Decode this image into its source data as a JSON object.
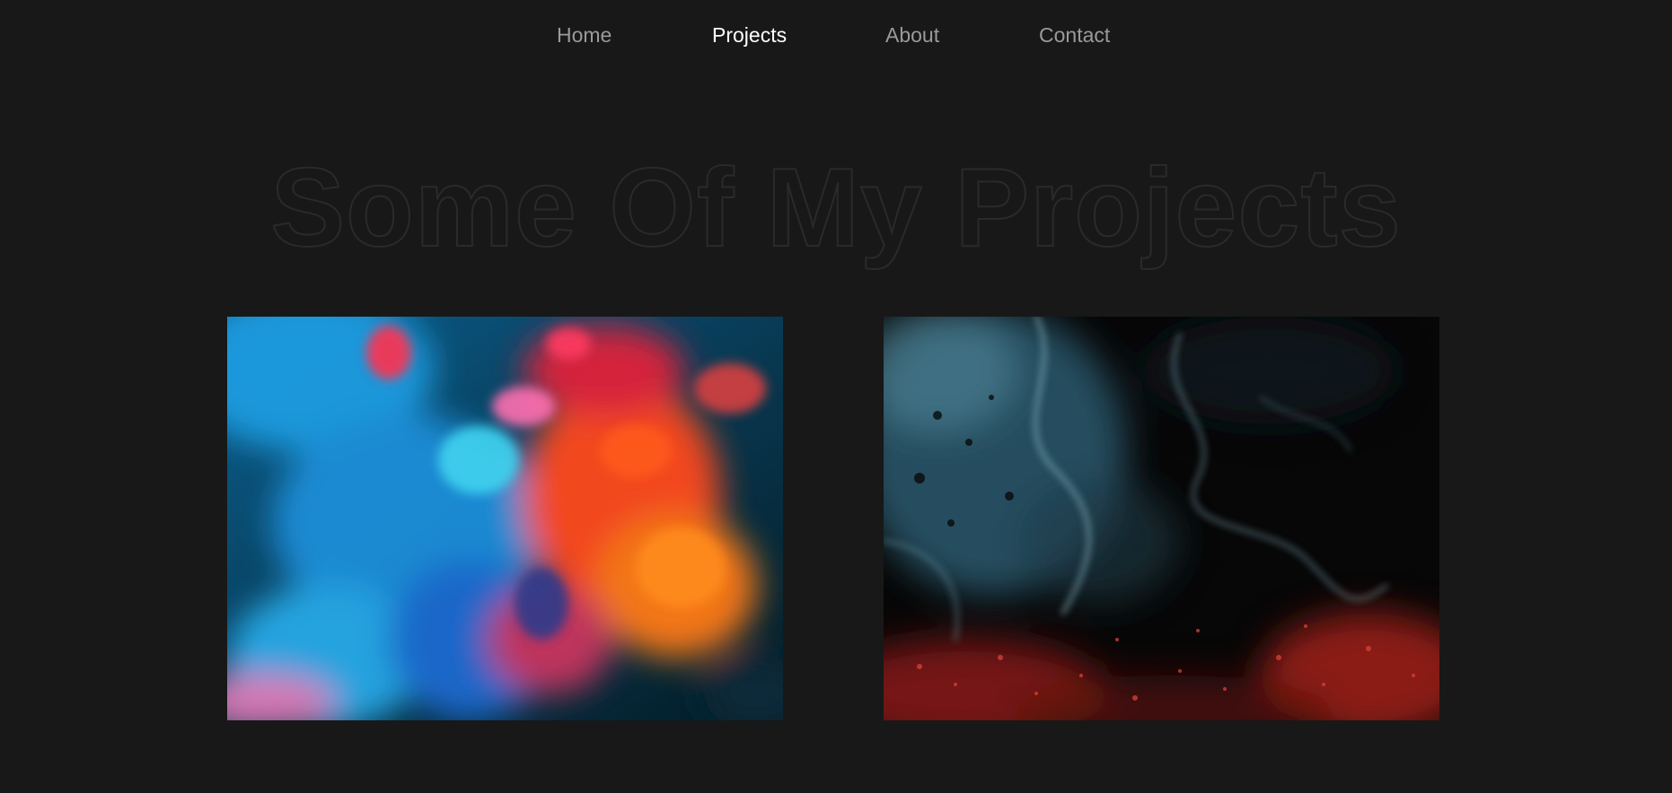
{
  "nav": {
    "items": [
      {
        "label": "Home",
        "active": false
      },
      {
        "label": "Projects",
        "active": true
      },
      {
        "label": "About",
        "active": false
      },
      {
        "label": "Contact",
        "active": false
      }
    ]
  },
  "page": {
    "title": "Some Of My Projects"
  },
  "projects": [
    {
      "image": "blue-orange-ink-smoke-image"
    },
    {
      "image": "dark-blue-red-fluid-art-image"
    }
  ],
  "colors": {
    "background": "#181818",
    "nav_text": "#9a9a9a",
    "nav_active": "#ffffff",
    "title_outline": "#2a2a2a"
  }
}
